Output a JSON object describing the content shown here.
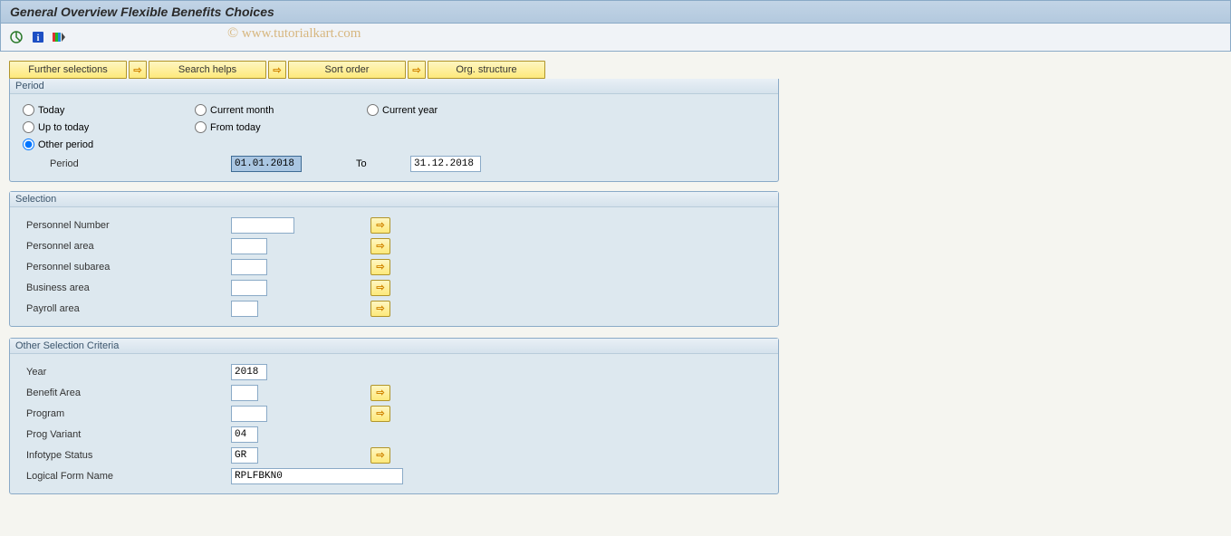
{
  "title": "General Overview Flexible Benefits Choices",
  "watermark": "www.tutorialkart.com",
  "tabs": {
    "further_selections": "Further selections",
    "search_helps": "Search helps",
    "sort_order": "Sort order",
    "org_structure": "Org. structure"
  },
  "period": {
    "header": "Period",
    "today": "Today",
    "up_to_today": "Up to today",
    "other_period": "Other period",
    "current_month": "Current month",
    "from_today": "From today",
    "current_year": "Current year",
    "period_label": "Period",
    "period_from": "01.01.2018",
    "to_label": "To",
    "period_to": "31.12.2018"
  },
  "selection": {
    "header": "Selection",
    "personnel_number": "Personnel Number",
    "personnel_area": "Personnel area",
    "personnel_subarea": "Personnel subarea",
    "business_area": "Business area",
    "payroll_area": "Payroll area"
  },
  "other": {
    "header": "Other Selection Criteria",
    "year": "Year",
    "year_val": "2018",
    "benefit_area": "Benefit Area",
    "program": "Program",
    "prog_variant": "Prog Variant",
    "prog_variant_val": "04",
    "infotype_status": "Infotype Status",
    "infotype_status_val": "GR",
    "logical_form_name": "Logical Form Name",
    "logical_form_name_val": "RPLFBKN0"
  }
}
